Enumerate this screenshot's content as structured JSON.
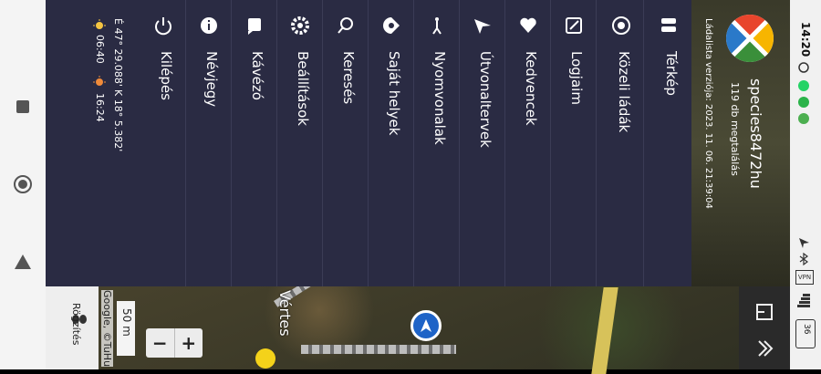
{
  "status_bar": {
    "time": "14:20",
    "battery": "36"
  },
  "header": {
    "username": "species8472hu",
    "found_count": "119 db megtalálás",
    "list_version": "Ládalista verziója: 2023. 11. 06. 21:39:04"
  },
  "menu": [
    {
      "label": "Térkép",
      "icon": "map-layers-icon"
    },
    {
      "label": "Közeli ládák",
      "icon": "target-icon"
    },
    {
      "label": "Logjaim",
      "icon": "log-edit-icon"
    },
    {
      "label": "Kedvencek",
      "icon": "heart-icon"
    },
    {
      "label": "Útvonaltervek",
      "icon": "navigation-arrow-icon"
    },
    {
      "label": "Nyomvonalak",
      "icon": "walking-icon"
    },
    {
      "label": "Saját helyek",
      "icon": "place-pin-icon"
    },
    {
      "label": "Keresés",
      "icon": "search-icon"
    },
    {
      "label": "Beállítások",
      "icon": "gear-icon"
    },
    {
      "label": "Kávézó",
      "icon": "chat-bubble-icon"
    },
    {
      "label": "Névjegy",
      "icon": "info-icon"
    },
    {
      "label": "Kilépés",
      "icon": "power-icon"
    }
  ],
  "location": {
    "lat": "É 47° 29.088'",
    "lon": "K 18° 5.382'",
    "sunrise": "06:40",
    "sunset": "16:24"
  },
  "map": {
    "scale": "50 m",
    "attribution": "Google, ©TuHu",
    "record_label": "Rögzítés",
    "partial_label": "Vértes",
    "zoom_out": "−",
    "zoom_in": "+"
  },
  "colors": {
    "drawer_bg": "#2a2b43",
    "accent": "#1e63c7"
  }
}
